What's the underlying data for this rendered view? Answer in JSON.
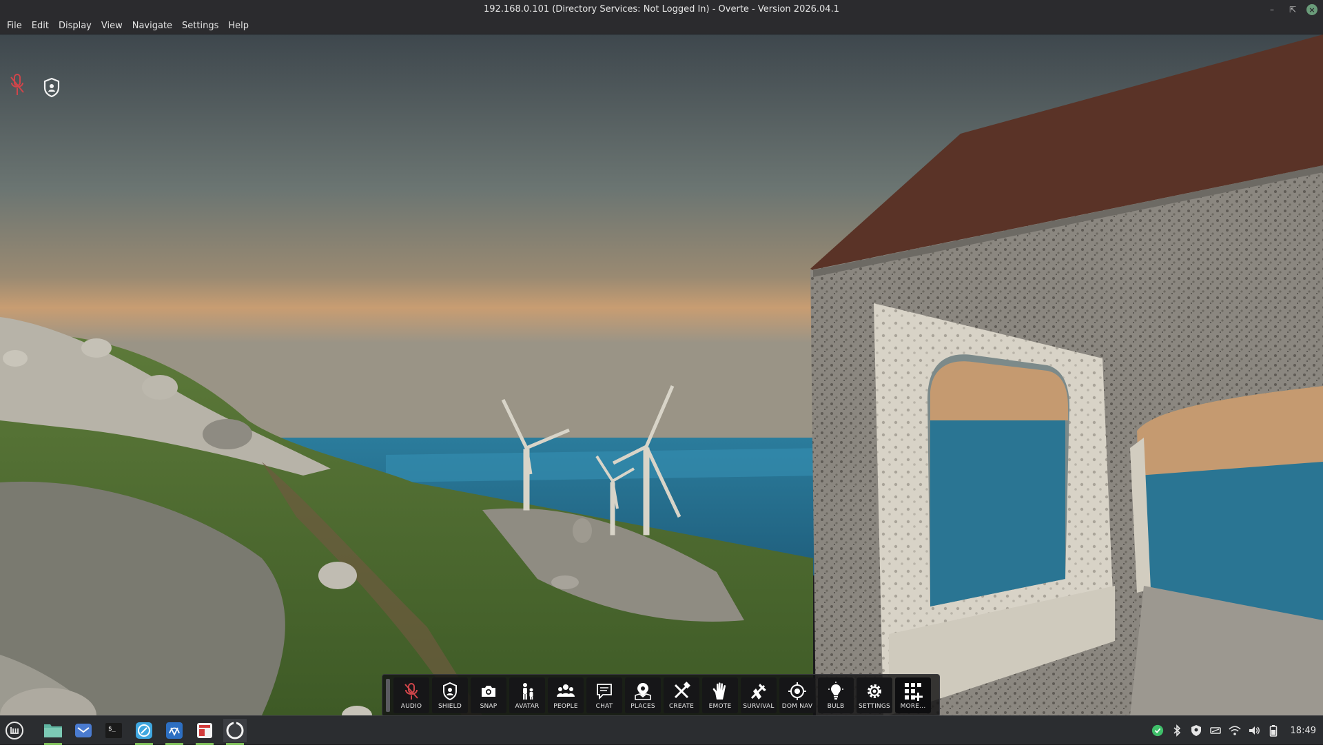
{
  "window": {
    "title": "192.168.0.101 (Directory Services: Not Logged In) - Overte - Version 2026.04.1",
    "controls": [
      "minimize-icon",
      "restore-icon",
      "close-icon"
    ]
  },
  "menu": {
    "items": [
      "File",
      "Edit",
      "Display",
      "View",
      "Navigate",
      "Settings",
      "Help"
    ]
  },
  "hud": {
    "mic_icon": "muted-mic-icon",
    "shield_icon": "shield-icon",
    "mic_color": "#d0454a"
  },
  "toolbar": {
    "buttons": [
      {
        "label": "AUDIO",
        "icon": "mic-muted-icon"
      },
      {
        "label": "SHIELD",
        "icon": "shield-icon"
      },
      {
        "label": "SNAP",
        "icon": "camera-icon"
      },
      {
        "label": "AVATAR",
        "icon": "avatar-icon"
      },
      {
        "label": "PEOPLE",
        "icon": "people-icon"
      },
      {
        "label": "CHAT",
        "icon": "chat-icon"
      },
      {
        "label": "PLACES",
        "icon": "places-icon"
      },
      {
        "label": "CREATE",
        "icon": "create-icon"
      },
      {
        "label": "EMOTE",
        "icon": "hand-icon"
      },
      {
        "label": "SURVIVAL",
        "icon": "survival-icon"
      },
      {
        "label": "DOM NAV",
        "icon": "target-icon"
      },
      {
        "label": "BULB",
        "icon": "bulb-icon"
      },
      {
        "label": "SETTINGS",
        "icon": "gear-icon"
      },
      {
        "label": "MORE...",
        "icon": "apps-plus-icon"
      }
    ]
  },
  "taskbar": {
    "apps": [
      "mint-menu-icon",
      "files-icon",
      "mail-icon",
      "terminal-icon",
      "browser-icon",
      "app-icon",
      "software-icon",
      "overte-icon"
    ],
    "tray": [
      "update-icon",
      "bluetooth-icon",
      "shield-tray-icon",
      "network-icon",
      "wifi-icon",
      "volume-icon",
      "battery-icon"
    ],
    "clock": "18:49"
  },
  "colors": {
    "accent_green": "#7fbf5a",
    "audio_red": "#d0454a"
  }
}
